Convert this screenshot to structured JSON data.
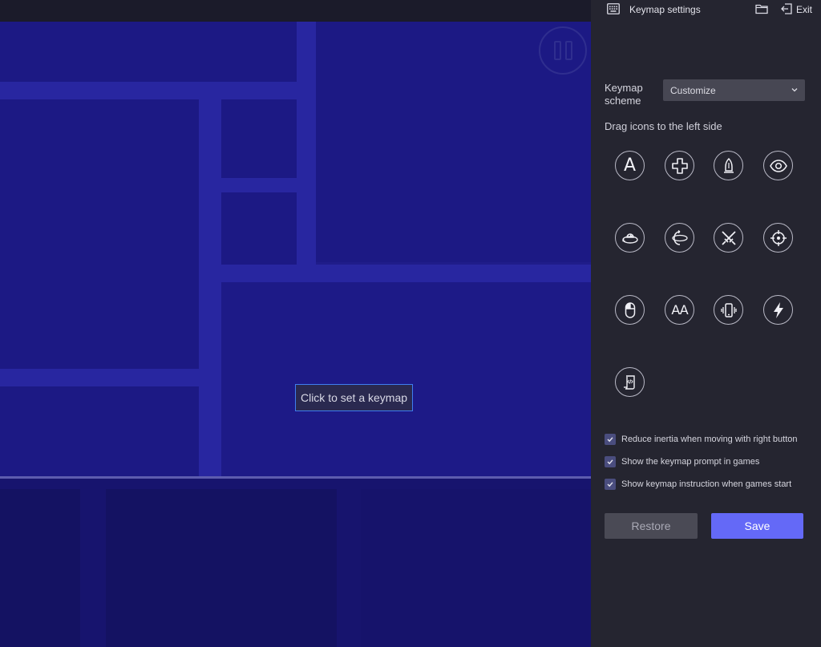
{
  "header": {
    "title": "Keymap settings",
    "exit_label": "Exit",
    "keyboard_icon": "keyboard-icon",
    "folder_icon": "folder-icon",
    "exit_icon": "exit-icon"
  },
  "game": {
    "pause_icon": "pause-icon",
    "tip": "Click to set a keymap"
  },
  "keymap": {
    "scheme_label": "Keymap scheme",
    "scheme_value": "Customize",
    "drag_hint": "Drag icons to the left side"
  },
  "icons": [
    {
      "name": "tap-key-icon",
      "text": "A"
    },
    {
      "name": "dpad-icon"
    },
    {
      "name": "skill-cast-icon"
    },
    {
      "name": "view-eye-icon"
    },
    {
      "name": "rotate-view-icon"
    },
    {
      "name": "free-look-icon"
    },
    {
      "name": "swords-attack-icon"
    },
    {
      "name": "crosshair-aim-icon"
    },
    {
      "name": "mouse-icon"
    },
    {
      "name": "repeat-tap-icon",
      "text": "AA"
    },
    {
      "name": "shake-phone-icon"
    },
    {
      "name": "lightning-icon"
    },
    {
      "name": "script-macro-icon"
    }
  ],
  "options": [
    {
      "label": "Reduce inertia when moving with right button",
      "checked": true
    },
    {
      "label": "Show the keymap prompt in games",
      "checked": true
    },
    {
      "label": "Show keymap instruction when games start",
      "checked": true
    }
  ],
  "buttons": {
    "restore": "Restore",
    "save": "Save"
  },
  "colors": {
    "accent": "#6469f7",
    "panel_bg": "#252530",
    "game_bg": "#1f1c8a",
    "tip_border": "#3f7df0"
  }
}
